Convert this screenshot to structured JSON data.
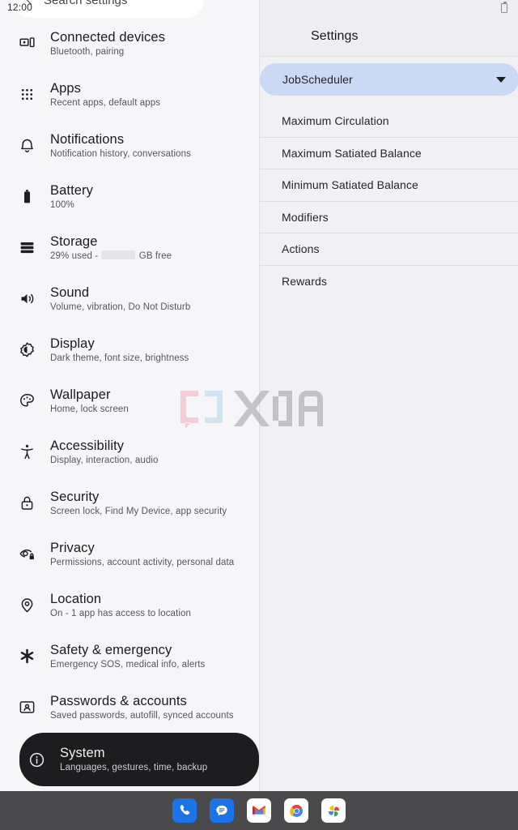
{
  "status_bar": {
    "clock": "12:00",
    "battery_icon": "battery-icon"
  },
  "left_pane": {
    "search_bar": {
      "back_icon": "back-arrow-icon",
      "text": "Search settings"
    },
    "items": [
      {
        "icon": "connected-devices-icon",
        "title": "Connected devices",
        "subtitle": "Bluetooth, pairing",
        "selected": false
      },
      {
        "icon": "apps-grid-icon",
        "title": "Apps",
        "subtitle": "Recent apps, default apps",
        "selected": false
      },
      {
        "icon": "bell-icon",
        "title": "Notifications",
        "subtitle": "Notification history, conversations",
        "selected": false
      },
      {
        "icon": "battery-icon",
        "title": "Battery",
        "subtitle": "100%",
        "selected": false
      },
      {
        "icon": "storage-icon",
        "title": "Storage",
        "subtitle_before": "29% used - ",
        "subtitle_redacted": true,
        "subtitle_after": " GB free",
        "selected": false
      },
      {
        "icon": "sound-icon",
        "title": "Sound",
        "subtitle": "Volume, vibration, Do Not Disturb",
        "selected": false
      },
      {
        "icon": "display-brightness-icon",
        "title": "Display",
        "subtitle": "Dark theme, font size, brightness",
        "selected": false
      },
      {
        "icon": "palette-icon",
        "title": "Wallpaper",
        "subtitle": "Home, lock screen",
        "selected": false
      },
      {
        "icon": "accessibility-icon",
        "title": "Accessibility",
        "subtitle": "Display, interaction, audio",
        "selected": false
      },
      {
        "icon": "lock-icon",
        "title": "Security",
        "subtitle": "Screen lock, Find My Device, app security",
        "selected": false
      },
      {
        "icon": "privacy-eye-icon",
        "title": "Privacy",
        "subtitle": "Permissions, account activity, personal data",
        "selected": false
      },
      {
        "icon": "location-pin-icon",
        "title": "Location",
        "subtitle": "On - 1 app has access to location",
        "selected": false
      },
      {
        "icon": "asterisk-icon",
        "title": "Safety & emergency",
        "subtitle": "Emergency SOS, medical info, alerts",
        "selected": false
      },
      {
        "icon": "passwords-accounts-icon",
        "title": "Passwords & accounts",
        "subtitle": "Saved passwords, autofill, synced accounts",
        "selected": false
      },
      {
        "icon": "info-circle-icon",
        "title": "System",
        "subtitle": "Languages, gestures, time, backup",
        "selected": true
      }
    ]
  },
  "right_pane": {
    "app_title": "Settings",
    "spinner": {
      "selected_value": "JobScheduler",
      "caret_icon": "chevron-down-icon"
    },
    "preferences": [
      {
        "label": "Maximum Circulation"
      },
      {
        "label": "Maximum Satiated Balance"
      },
      {
        "label": "Minimum Satiated Balance"
      },
      {
        "label": "Modifiers"
      },
      {
        "label": "Actions"
      },
      {
        "label": "Rewards"
      }
    ]
  },
  "watermark": {
    "text": "XDA",
    "bracket_left_color": "#f3b6c2",
    "bracket_right_color": "#b9dcee",
    "letters_color": "#a8a8ac"
  },
  "taskbar": {
    "apps": [
      {
        "name": "phone-app-icon",
        "label": "Phone"
      },
      {
        "name": "messages-app-icon",
        "label": "Messages"
      },
      {
        "name": "gmail-app-icon",
        "label": "Gmail"
      },
      {
        "name": "chrome-app-icon",
        "label": "Chrome"
      },
      {
        "name": "photos-app-icon",
        "label": "Photos"
      }
    ]
  },
  "theme": {
    "accent_spinner": "#ccd9f5",
    "selected_row_bg": "#1d1d1f",
    "taskbar_bg": "#4a4a4c",
    "left_bg": "#f6f6f8",
    "right_bg": "#f1f1f3"
  }
}
